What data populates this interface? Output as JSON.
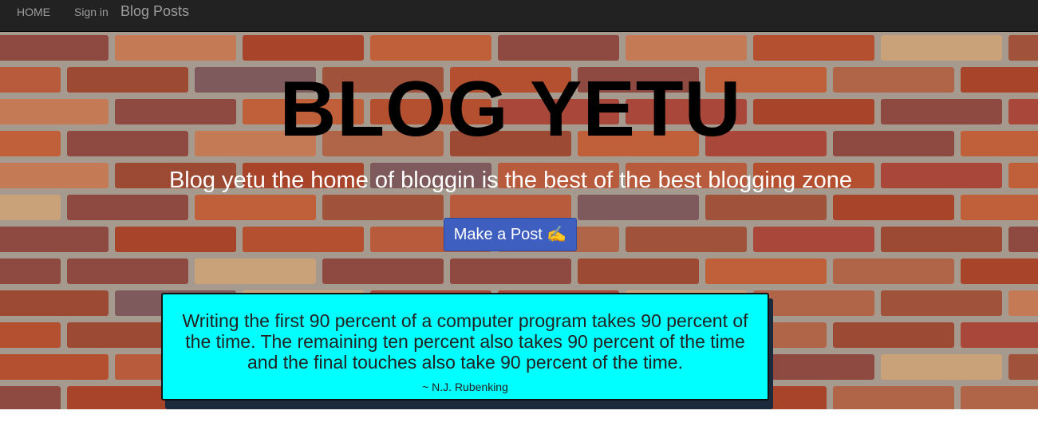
{
  "navbar": {
    "home_label": "HOME",
    "signin_label": "Sign in",
    "brand_label": "Blog Posts"
  },
  "hero": {
    "title": "BLOG YETU",
    "subtitle": "Blog yetu the home of bloggin is the best of the best blogging zone",
    "button_label": "Make a Post ✍️"
  },
  "quote": {
    "text": "Writing the first 90 percent of a computer program takes 90 percent of the time. The remaining ten percent also takes 90 percent of the time and the final touches also take 90 percent of the time.",
    "author": "~ N.J. Rubenking"
  },
  "colors": {
    "navbar_bg": "#222222",
    "button_bg": "#3f5fc0",
    "quote_bg": "#00ffff",
    "brick_red": "#b4502f"
  }
}
